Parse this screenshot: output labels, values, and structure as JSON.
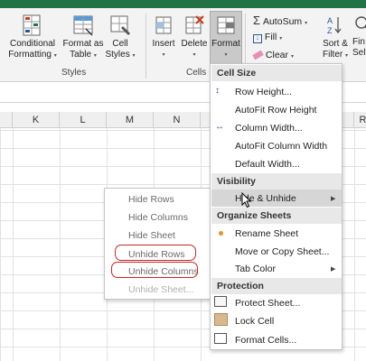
{
  "ribbon": {
    "conditional_formatting_label": "Conditional Formatting",
    "cf_line1": "Conditional",
    "cf_line2": "Formatting",
    "format_as_table_line1": "Format as",
    "format_as_table_line2": "Table",
    "cell_styles_line1": "Cell",
    "cell_styles_line2": "Styles",
    "insert_label": "Insert",
    "delete_label": "Delete",
    "format_label": "Format",
    "styles_group": "Styles",
    "cells_group": "Cells",
    "autosum_label": "AutoSum",
    "fill_label": "Fill",
    "clear_label": "Clear",
    "sort_line1": "Sort &",
    "sort_line2": "Filter",
    "find_line1": "Fin",
    "find_line2": "Sele"
  },
  "columns": [
    "K",
    "L",
    "M",
    "N",
    "R"
  ],
  "format_menu": {
    "cell_size_header": "Cell Size",
    "row_height": "Row Height...",
    "autofit_row_height": "AutoFit Row Height",
    "column_width": "Column Width...",
    "autofit_column_width": "AutoFit Column Width",
    "default_width": "Default Width...",
    "visibility_header": "Visibility",
    "hide_unhide": "Hide & Unhide",
    "organize_header": "Organize Sheets",
    "rename_sheet": "Rename Sheet",
    "move_copy_sheet": "Move or Copy Sheet...",
    "tab_color": "Tab Color",
    "protection_header": "Protection",
    "protect_sheet": "Protect Sheet...",
    "lock_cell": "Lock Cell",
    "format_cells": "Format Cells..."
  },
  "hide_submenu": {
    "hide_rows": "Hide Rows",
    "hide_columns": "Hide Columns",
    "hide_sheet": "Hide Sheet",
    "unhide_rows": "Unhide Rows",
    "unhide_columns": "Unhide Columns",
    "unhide_sheet": "Unhide Sheet..."
  },
  "colors": {
    "excel_green": "#217346",
    "highlight_oval": "#c0282d",
    "menu_section_bg": "#e8e8e8",
    "hover_bg": "#d6d6d6"
  }
}
